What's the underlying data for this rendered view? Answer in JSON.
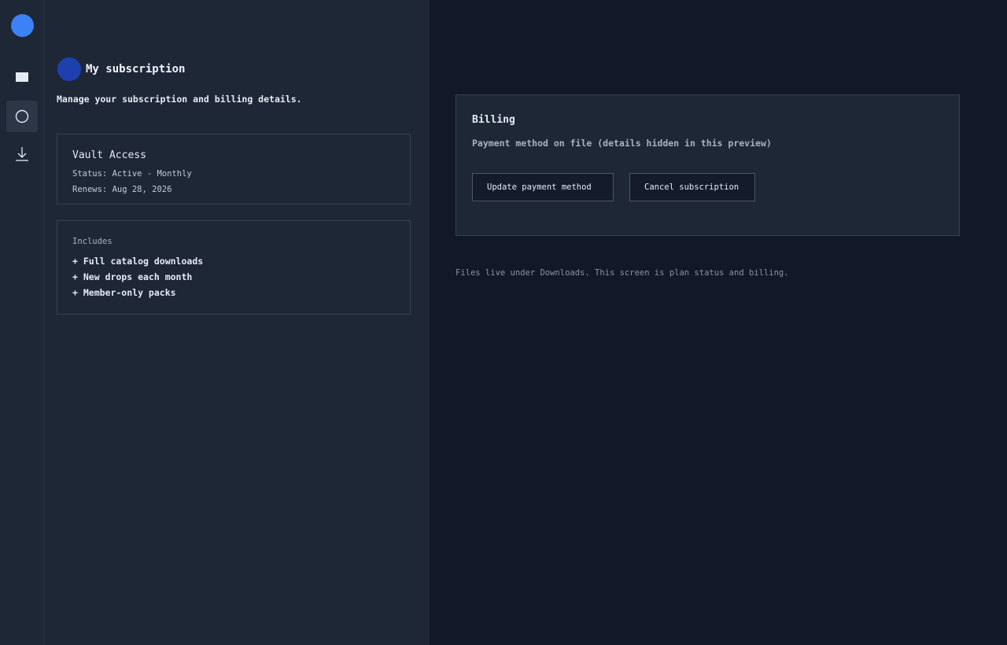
{
  "rail": {
    "items": [
      {
        "icon": "library-icon"
      },
      {
        "icon": "subscription-icon",
        "active": true
      },
      {
        "icon": "download-icon"
      }
    ]
  },
  "header": {
    "title": "My subscription",
    "subtitle": "Manage your subscription and billing details."
  },
  "plan": {
    "name": "Vault Access",
    "status": "Status: Active - Monthly",
    "renews": "Renews: Aug 28, 2026"
  },
  "includes": {
    "label": "Includes",
    "items": [
      "+ Full catalog downloads",
      "+ New drops each month",
      "+ Member-only packs"
    ]
  },
  "billing": {
    "title": "Billing",
    "note": "Payment method on file (details hidden in this preview)",
    "update_label": "Update payment method",
    "cancel_label": "Cancel subscription"
  },
  "footer": {
    "note": "Files live under Downloads. This screen is plan status and billing."
  },
  "colors": {
    "accent": "#3b82f6",
    "avatar": "#1e40af",
    "panel": "#1e2736",
    "background": "#121828"
  }
}
